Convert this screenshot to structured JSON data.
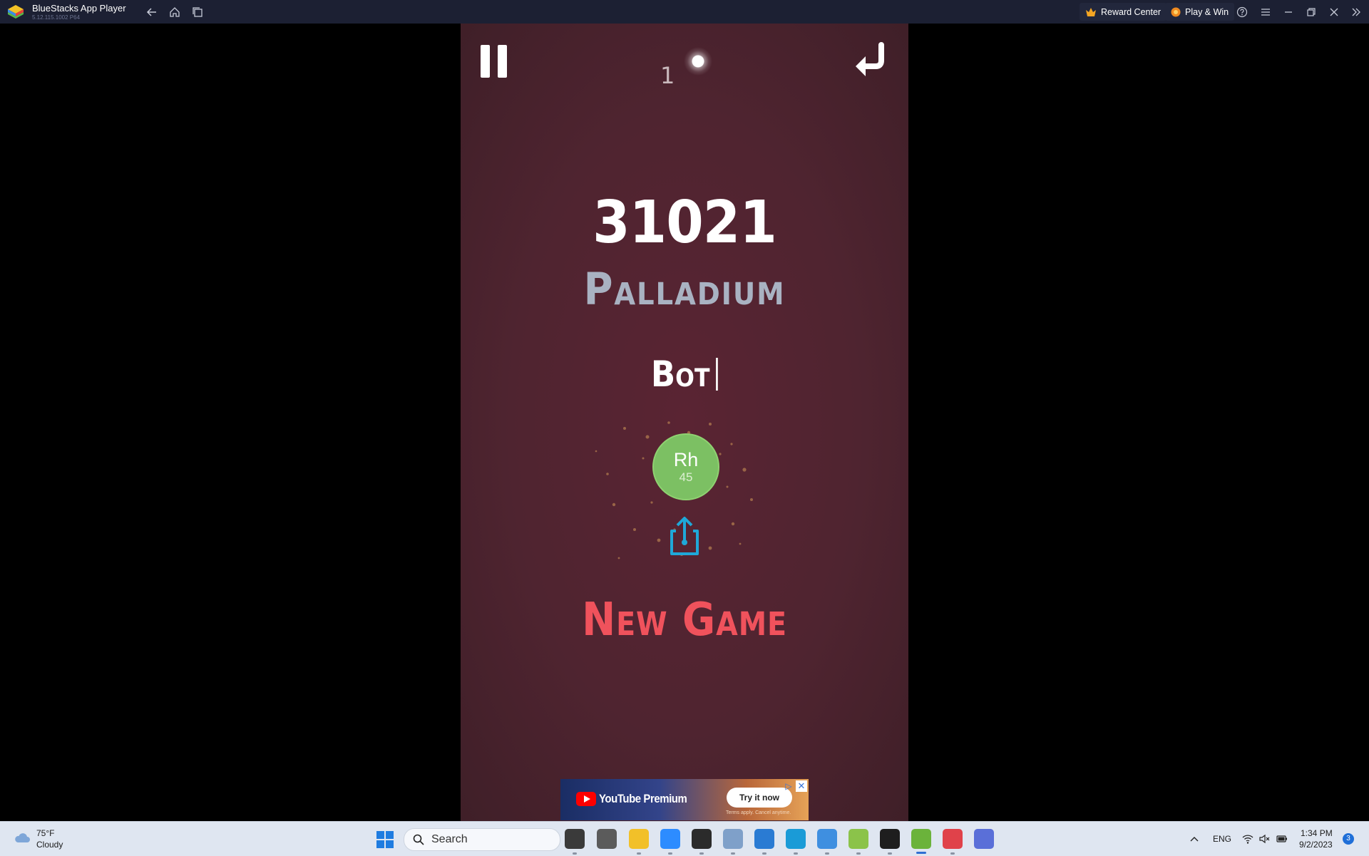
{
  "titlebar": {
    "app_name": "BlueStacks App Player",
    "version": "5.12.115.1002  P64",
    "reward_center": "Reward Center",
    "play_win": "Play & Win"
  },
  "game": {
    "moves_left": "1",
    "score": "31021",
    "best_element_name": "Palladium",
    "player_name": "Bot",
    "atom": {
      "symbol": "Rh",
      "number": "45",
      "color": "#7cc063"
    },
    "new_game_label": "New Game",
    "new_game_color": "#f0525c"
  },
  "ad": {
    "brand": "YouTube Premium",
    "cta": "Try it now",
    "terms": "Terms apply. Cancel anytime."
  },
  "taskbar": {
    "weather_temp": "75°F",
    "weather_condition": "Cloudy",
    "search_placeholder": "Search",
    "language": "ENG",
    "time": "1:34 PM",
    "date": "9/2/2023",
    "notification_count": "3",
    "apps": [
      {
        "name": "file-manager-app",
        "color": "#3a3a3a"
      },
      {
        "name": "dx-app",
        "color": "#5b5b5b"
      },
      {
        "name": "file-explorer-app",
        "color": "#f2c029"
      },
      {
        "name": "zoom-app",
        "color": "#2d8cff"
      },
      {
        "name": "terminal-app",
        "color": "#2b2b2b"
      },
      {
        "name": "photos-app",
        "color": "#7fa0c9"
      },
      {
        "name": "vscode-app",
        "color": "#2a7bd3"
      },
      {
        "name": "edge-app",
        "color": "#1a9bd7"
      },
      {
        "name": "paint-app",
        "color": "#3f8fe0"
      },
      {
        "name": "notepad-app",
        "color": "#8bc34a"
      },
      {
        "name": "console-app",
        "color": "#1e1e1e"
      },
      {
        "name": "bluestacks-app",
        "color": "#6bb33b"
      },
      {
        "name": "snipping-tool-app",
        "color": "#e0424a"
      },
      {
        "name": "vpn-app",
        "color": "#5a6fd8"
      }
    ]
  }
}
